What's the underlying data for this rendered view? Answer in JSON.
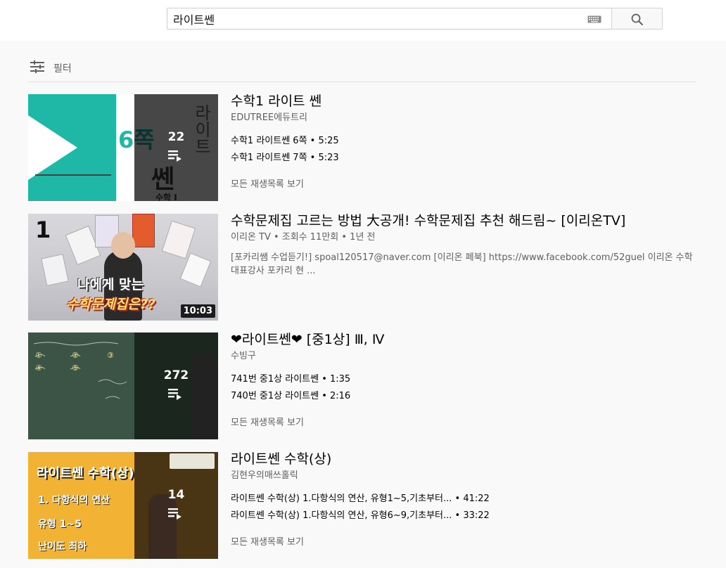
{
  "search": {
    "query": "라이트쎈",
    "icon": "search-icon",
    "keyboard_icon": "keyboard-icon"
  },
  "filter": {
    "label": "필터",
    "icon": "filter-sliders-icon"
  },
  "results": [
    {
      "type": "playlist",
      "title": "수학1 라이트 쎈",
      "channel": "EDUTREE에듀트리",
      "count": "22",
      "items": [
        "수학1 라이트쎈 6쪽 • 5:25",
        "수학1 라이트쎈 7쪽 • 5:23"
      ],
      "view_all": "모든 재생목록 보기",
      "thumb_text": {
        "left_label": "6쪽",
        "vertical": "라이트",
        "bottom": "쎈",
        "corner": "수학 I"
      }
    },
    {
      "type": "video",
      "title": "수학문제집 고르는 방법 大공개! 수학문제집 추천 해드림~ [이리온TV]",
      "channel_meta": "이리온 TV • 조회수 11만회 • 1년 전",
      "description": "[포카리쌤 수업듣기!] spoal120517@naver.com [이리온 페북] https://www.facebook.com/52guel 이리온 수학 대표강사 포카리 현 ...",
      "duration": "10:03",
      "thumb_text": {
        "num": "1",
        "line1": "나에게 맞는",
        "line2": "수학문제집은??"
      }
    },
    {
      "type": "playlist",
      "title": "❤라이트쎈❤ [중1상] Ⅲ, Ⅳ",
      "channel": "수빙구",
      "count": "272",
      "items": [
        "741번 중1상 라이트쎈 • 1:35",
        "740번 중1상 라이트쎈 • 2:16"
      ],
      "view_all": "모든 재생목록 보기"
    },
    {
      "type": "playlist",
      "title": "라이트쎈 수학(상)",
      "channel": "김현우의매쓰홀릭",
      "count": "14",
      "items": [
        "라이트쎈 수학(상) 1.다항식의 연산, 유형1~5,기초부터... • 41:22",
        "라이트쎈 수학(상) 1.다항식의 연산, 유형6~9,기초부터... • 33:22"
      ],
      "view_all": "모든 재생목록 보기",
      "thumb_text": {
        "t1": "라이트쎈 수학(상)",
        "t2": "1. 다항식의 연산",
        "t3": "유형 1~5",
        "t4": "난이도 최하"
      }
    }
  ],
  "colors": {
    "accent_teal": "#1fb7a6",
    "board_green": "#3c5446",
    "thumb_yellow": "#f2b233",
    "title_text": "#030303",
    "meta_text": "#606060"
  }
}
